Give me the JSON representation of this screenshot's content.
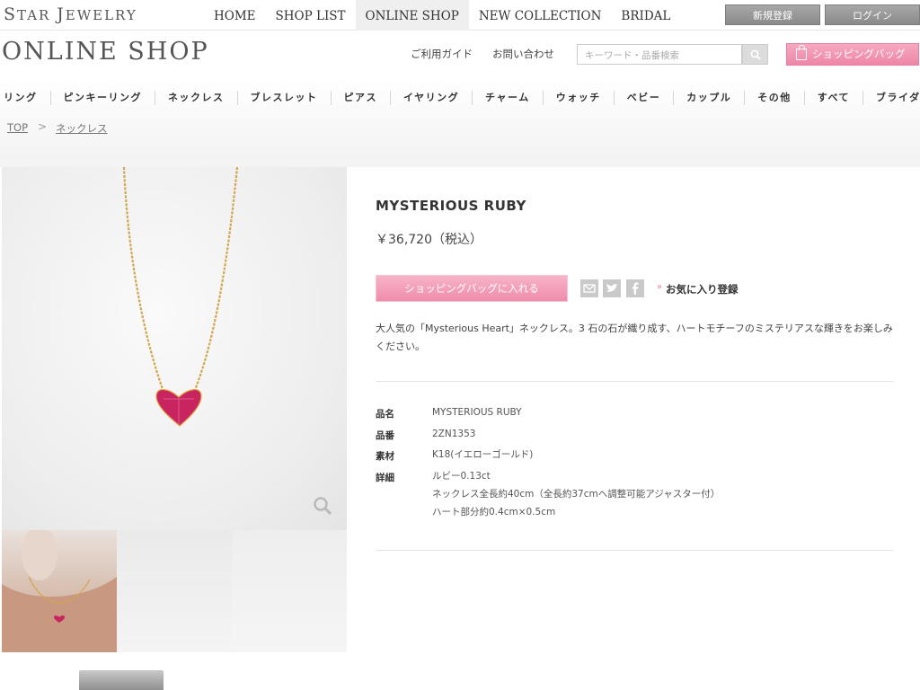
{
  "topbar": {
    "brand_first_S": "S",
    "brand_rest1": "TAR ",
    "brand_J": "J",
    "brand_rest2": "EWELRY",
    "nav": [
      "HOME",
      "SHOP LIST",
      "ONLINE SHOP",
      "NEW COLLECTION",
      "BRIDAL"
    ],
    "register": "新規登録",
    "login": "ログイン"
  },
  "header": {
    "title": "ONLINE SHOP",
    "guide": "ご利用ガイド",
    "contact": "お問い合わせ",
    "search_placeholder": "キーワード・品番検索",
    "shopping_bag": "ショッピングバッグ"
  },
  "categories": [
    "リング",
    "ピンキーリング",
    "ネックレス",
    "ブレスレット",
    "ピアス",
    "イヤリング",
    "チャーム",
    "ウォッチ",
    "ベビー",
    "カップル",
    "その他",
    "すべて",
    "ブライダル"
  ],
  "breadcrumb": {
    "top": "TOP",
    "separator": ">",
    "current": "ネックレス"
  },
  "product": {
    "name": "MYSTERIOUS RUBY",
    "price": "￥36,720（税込）",
    "add_to_bag": "ショッピングバッグに入れる",
    "favorite": "お気に入り登録",
    "favorite_arrow": "»",
    "description": "大人気の「Mysterious Heart」ネックレス。3 石の石が織り成す、ハートモチーフのミステリアスな輝きをお楽しみください。",
    "specs": {
      "name_label": "品名",
      "name_value": "MYSTERIOUS RUBY",
      "code_label": "品番",
      "code_value": "2ZN1353",
      "material_label": "素材",
      "material_value": "K18(イエローゴールド)",
      "detail_label": "詳細",
      "detail_line1": "ルビー0.13ct",
      "detail_line2": "ネックレス全長約40cm（全長約37cmへ調整可能アジャスター付）",
      "detail_line3": "ハート部分約0.4cm×0.5cm"
    }
  },
  "colors": {
    "accent_pink": "#ef8dac",
    "ruby": "#c8245f",
    "gold": "#d3a54e"
  }
}
